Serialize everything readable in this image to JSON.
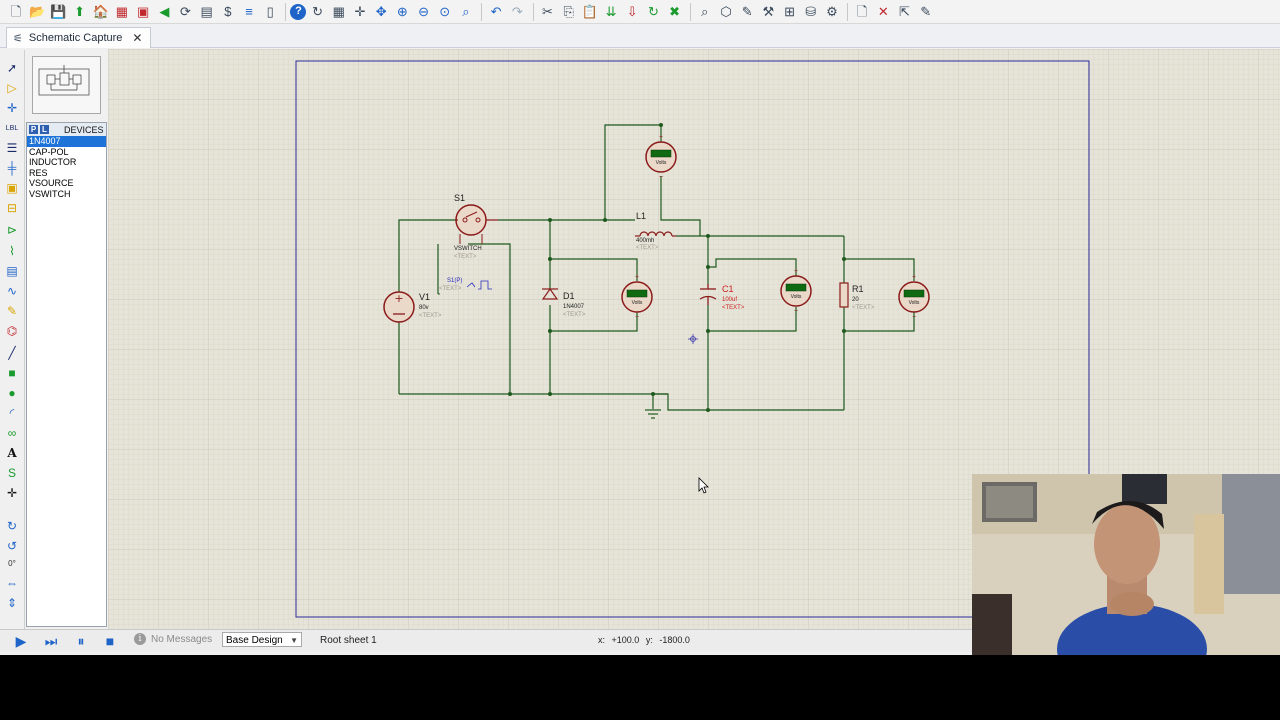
{
  "toolbar": {
    "icons": [
      "new-file-icon",
      "open-folder-icon",
      "save-icon",
      "import-icon",
      "home-icon",
      "pcb-icon",
      "chip-icon",
      "back-icon",
      "refresh-view-icon",
      "gerber-icon",
      "bom-icon",
      "netlist-icon",
      "blank-page-icon",
      "help-icon",
      "redraw-icon",
      "grid-icon",
      "origin-icon",
      "pan-icon",
      "zoom-in-icon",
      "zoom-out-icon",
      "zoom-all-icon",
      "zoom-area-icon",
      "undo-icon",
      "redo-icon",
      "cut-icon",
      "copy-icon",
      "paste-icon",
      "block-copy-icon",
      "block-move-icon",
      "block-rotate-icon",
      "block-delete-icon",
      "pick-device-icon",
      "make-device-icon",
      "packaging-tool-icon",
      "decompose-icon",
      "wire-autorouter-icon",
      "search-tag-icon",
      "property-assignment-icon",
      "new-sheet-icon",
      "remove-sheet-icon",
      "exit-parent-icon",
      "netlist-to-ares-icon"
    ]
  },
  "tab": {
    "label": "Schematic Capture"
  },
  "devices": {
    "p_label": "P",
    "l_label": "L",
    "title": "DEVICES",
    "items": [
      "1N4007",
      "CAP-POL",
      "INDUCTOR",
      "RES",
      "VSOURCE",
      "VSWITCH"
    ],
    "selected_index": 0
  },
  "schematic": {
    "s1": {
      "ref": "S1",
      "value": "VSWITCH",
      "text": "<TEXT>",
      "pulse": "S1(P)",
      "pulse_text": "<TEXT>"
    },
    "v1": {
      "ref": "V1",
      "value": "80v",
      "text": "<TEXT>"
    },
    "d1": {
      "ref": "D1",
      "value": "1N4007",
      "text": "<TEXT>"
    },
    "l1": {
      "ref": "L1",
      "value": "400mh",
      "text": "<TEXT>"
    },
    "c1": {
      "ref": "C1",
      "value": "100uf",
      "text": "<TEXT>"
    },
    "r1": {
      "ref": "R1",
      "value": "20",
      "text": "<TEXT>"
    },
    "meter_unit": "Volts",
    "plus": "+",
    "minus": "−"
  },
  "status": {
    "messages": "No Messages",
    "design": "Base Design",
    "sheet": "Root sheet 1",
    "x_label": "x:",
    "x_value": "+100.0",
    "y_label": "y:",
    "y_value": "-1800.0"
  },
  "left_tools": {
    "rotation_value": "0°"
  },
  "colors": {
    "wire": "#1f5a1f",
    "component": "#8b1a1a",
    "canvas": "#e6e4d8",
    "border": "#1a1a8c"
  }
}
